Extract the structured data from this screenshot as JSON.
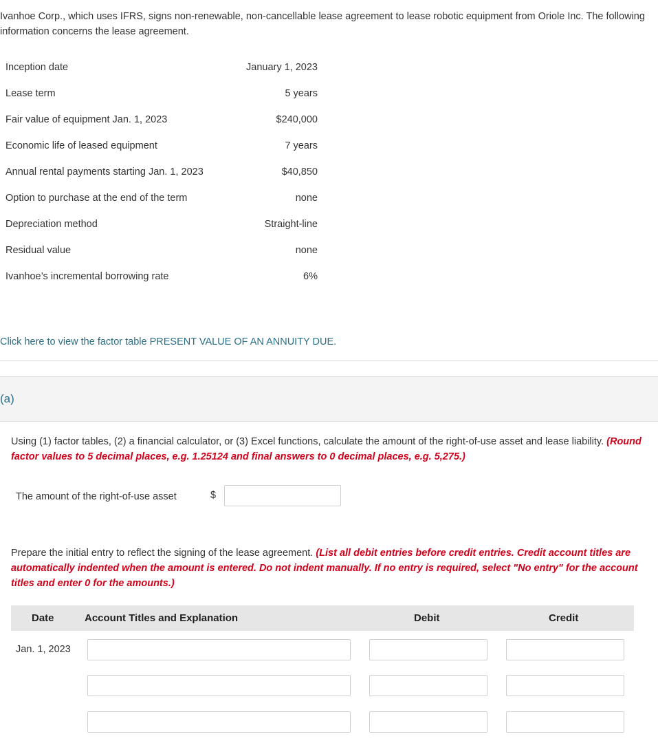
{
  "problem": {
    "intro": "Ivanhoe Corp., which uses IFRS, signs non-renewable, non-cancellable lease agreement to lease robotic equipment from Oriole Inc. The following information concerns the lease agreement.",
    "info_rows": [
      {
        "label": "Inception date",
        "value": "January 1, 2023"
      },
      {
        "label": "Lease term",
        "value": "5 years"
      },
      {
        "label": "Fair value of equipment Jan. 1, 2023",
        "value": "$240,000"
      },
      {
        "label": "Economic life of leased equipment",
        "value": "7 years"
      },
      {
        "label": "Annual rental payments starting Jan. 1, 2023",
        "value": "$40,850"
      },
      {
        "label": "Option to purchase at the end of the term",
        "value": "none"
      },
      {
        "label": "Depreciation method",
        "value": "Straight-line"
      },
      {
        "label": "Residual value",
        "value": "none"
      },
      {
        "label": "Ivanhoe’s incremental borrowing rate",
        "value": "6%"
      }
    ],
    "factor_link": "Click here to view the factor table PRESENT VALUE OF AN ANNUITY DUE."
  },
  "part_a": {
    "label": "(a)",
    "question": "Using (1) factor tables, (2) a financial calculator, or (3) Excel functions, calculate the amount of the right-of-use asset and lease liability.",
    "question_note": "(Round factor values to 5 decimal places, e.g. 1.25124 and final answers to 0 decimal places, e.g. 5,275.)",
    "rou_label": "The amount of the right-of-use asset",
    "currency_symbol": "$",
    "rou_value": "",
    "entry_instruction": "Prepare the initial entry to reflect the signing of the lease agreement.",
    "entry_note": "(List all debit entries before credit entries. Credit account titles are automatically indented when the amount is entered. Do not indent manually. If no entry is required, select \"No entry\" for the account titles and enter 0 for the amounts.)",
    "journal": {
      "headers": {
        "date": "Date",
        "account": "Account Titles and Explanation",
        "debit": "Debit",
        "credit": "Credit"
      },
      "rows": [
        {
          "date": "Jan. 1, 2023",
          "account": "",
          "debit": "",
          "credit": ""
        },
        {
          "date": "",
          "account": "",
          "debit": "",
          "credit": ""
        },
        {
          "date": "",
          "account": "",
          "debit": "",
          "credit": ""
        }
      ]
    }
  },
  "colors": {
    "link": "#2a6f87",
    "instruction_red": "#d0021b",
    "band": "#f4f4f4",
    "header_bg": "#e6e6e6"
  }
}
